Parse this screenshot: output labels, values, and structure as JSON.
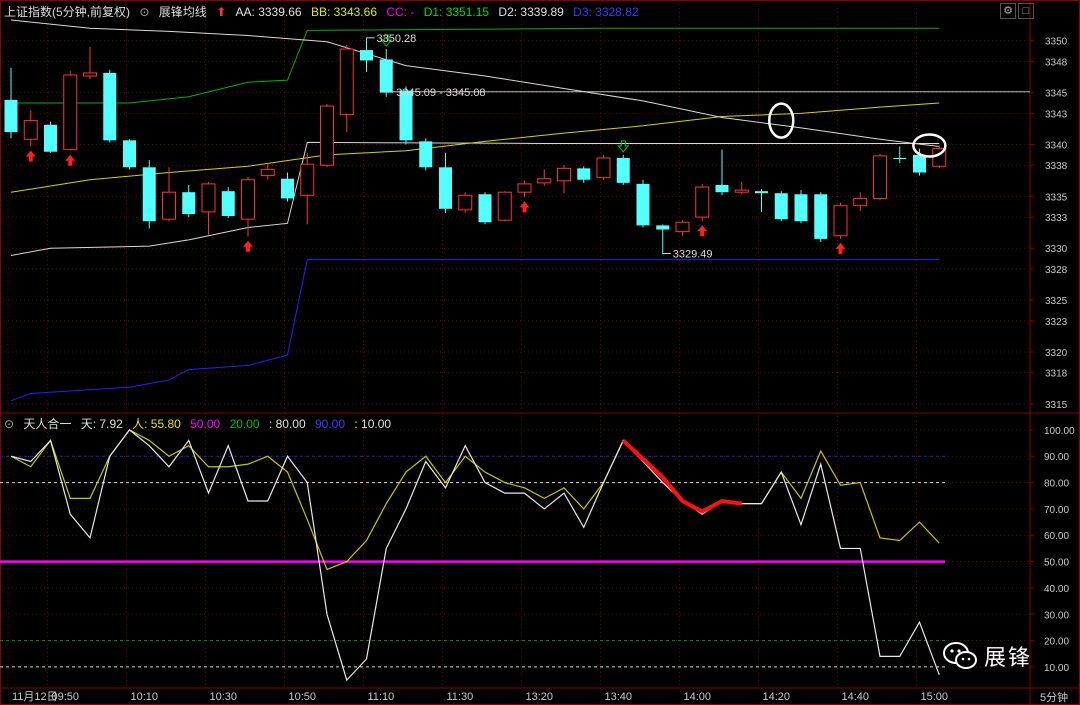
{
  "header": {
    "main_title": "上证指数(5分钟,前复权)",
    "indicator_name": "展锋均线",
    "aa": "AA: 3339.66",
    "bb": "BB: 3343.66",
    "cc": "CC: -",
    "d1": "D1: 3351.15",
    "d2": "D2: 3339.89",
    "d3": "D3: 3328.82"
  },
  "sub_header": {
    "name": "天人合一",
    "tian": "天: 7.92",
    "ren": "人: 55.80",
    "l50": "50.00",
    "l20": "20.00",
    "l80": ": 80.00",
    "l90": "90.00",
    "l10": ": 10.00"
  },
  "colors": {
    "up": "#ff3232",
    "down": "#54ffff",
    "aa": "#d8d8d8",
    "bb": "#d4d400",
    "d1": "#00b400",
    "d2": "#d8d8d8",
    "d3": "#2222ff",
    "magenta": "#ff00ff",
    "tian": "#e8e8e8",
    "ren": "#c8c800",
    "grid": "#8b0000"
  },
  "watermark": "展锋",
  "period_label": "5分钟",
  "chart_data": [
    {
      "type": "candlestick",
      "ylim": [
        3314.5,
        3352
      ],
      "yticks": [
        3315,
        3318,
        3320,
        3323,
        3325,
        3328,
        3330,
        3333,
        3335,
        3338,
        3340,
        3343,
        3345,
        3348,
        3350
      ],
      "candles": [
        {
          "o": 3344.3,
          "c": 3341.2,
          "h": 3347.4,
          "l": 3340.6
        },
        {
          "o": 3340.5,
          "c": 3342.3,
          "h": 3343.3,
          "l": 3339.8
        },
        {
          "o": 3341.9,
          "c": 3339.3,
          "h": 3342.2,
          "l": 3339.2
        },
        {
          "o": 3339.5,
          "c": 3346.7,
          "h": 3347.1,
          "l": 3339.4
        },
        {
          "o": 3346.6,
          "c": 3346.9,
          "h": 3349.4,
          "l": 3346.3
        },
        {
          "o": 3346.9,
          "c": 3340.4,
          "h": 3347.2,
          "l": 3340.2
        },
        {
          "o": 3340.4,
          "c": 3337.8,
          "h": 3340.5,
          "l": 3337.6
        },
        {
          "o": 3337.8,
          "c": 3332.6,
          "h": 3338.5,
          "l": 3331.9
        },
        {
          "o": 3332.8,
          "c": 3335.4,
          "h": 3337.8,
          "l": 3332.6
        },
        {
          "o": 3335.4,
          "c": 3333.3,
          "h": 3336.1,
          "l": 3333.0
        },
        {
          "o": 3333.5,
          "c": 3336.2,
          "h": 3336.4,
          "l": 3331.3
        },
        {
          "o": 3335.5,
          "c": 3333.1,
          "h": 3335.9,
          "l": 3332.9
        },
        {
          "o": 3332.8,
          "c": 3336.6,
          "h": 3336.9,
          "l": 3331.1
        },
        {
          "o": 3337.0,
          "c": 3337.6,
          "h": 3338.2,
          "l": 3336.6
        },
        {
          "o": 3336.7,
          "c": 3334.8,
          "h": 3337.3,
          "l": 3334.5
        },
        {
          "o": 3335.1,
          "c": 3338.1,
          "h": 3339.2,
          "l": 3332.3
        },
        {
          "o": 3338.0,
          "c": 3343.7,
          "h": 3343.9,
          "l": 3337.8
        },
        {
          "o": 3342.9,
          "c": 3349.2,
          "h": 3349.6,
          "l": 3341.2
        },
        {
          "o": 3349.1,
          "c": 3348.1,
          "h": 3350.3,
          "l": 3347.0
        },
        {
          "o": 3348.2,
          "c": 3345.0,
          "h": 3349.2,
          "l": 3344.6
        },
        {
          "o": 3345.2,
          "c": 3340.4,
          "h": 3345.6,
          "l": 3340.0
        },
        {
          "o": 3340.3,
          "c": 3337.8,
          "h": 3340.6,
          "l": 3337.5
        },
        {
          "o": 3337.8,
          "c": 3333.8,
          "h": 3339.2,
          "l": 3333.4
        },
        {
          "o": 3333.7,
          "c": 3335.1,
          "h": 3335.4,
          "l": 3333.4
        },
        {
          "o": 3335.2,
          "c": 3332.5,
          "h": 3335.4,
          "l": 3332.3
        },
        {
          "o": 3332.7,
          "c": 3335.4,
          "h": 3335.5,
          "l": 3332.6
        },
        {
          "o": 3335.4,
          "c": 3336.2,
          "h": 3336.5,
          "l": 3334.9
        },
        {
          "o": 3336.3,
          "c": 3336.7,
          "h": 3337.6,
          "l": 3336.0
        },
        {
          "o": 3336.5,
          "c": 3337.7,
          "h": 3338.0,
          "l": 3335.3
        },
        {
          "o": 3337.7,
          "c": 3336.6,
          "h": 3337.9,
          "l": 3336.3
        },
        {
          "o": 3336.8,
          "c": 3338.7,
          "h": 3339.0,
          "l": 3336.6
        },
        {
          "o": 3338.7,
          "c": 3336.3,
          "h": 3339.0,
          "l": 3336.1
        },
        {
          "o": 3336.2,
          "c": 3332.2,
          "h": 3336.6,
          "l": 3332.0
        },
        {
          "o": 3332.2,
          "c": 3331.8,
          "h": 3332.3,
          "l": 3329.4
        },
        {
          "o": 3331.6,
          "c": 3332.5,
          "h": 3332.7,
          "l": 3331.2
        },
        {
          "o": 3333.0,
          "c": 3335.9,
          "h": 3336.2,
          "l": 3332.6
        },
        {
          "o": 3336.1,
          "c": 3335.4,
          "h": 3339.5,
          "l": 3335.1
        },
        {
          "o": 3335.4,
          "c": 3335.6,
          "h": 3336.4,
          "l": 3335.2
        },
        {
          "o": 3335.5,
          "c": 3335.3,
          "h": 3335.7,
          "l": 3333.5
        },
        {
          "o": 3335.3,
          "c": 3332.8,
          "h": 3335.5,
          "l": 3332.6
        },
        {
          "o": 3335.2,
          "c": 3332.6,
          "h": 3335.6,
          "l": 3332.4
        },
        {
          "o": 3335.2,
          "c": 3330.9,
          "h": 3335.4,
          "l": 3330.6
        },
        {
          "o": 3331.2,
          "c": 3334.1,
          "h": 3334.4,
          "l": 3330.9
        },
        {
          "o": 3334.1,
          "c": 3334.8,
          "h": 3335.4,
          "l": 3333.6
        },
        {
          "o": 3334.8,
          "c": 3338.9,
          "h": 3339.1,
          "l": 3334.6
        },
        {
          "o": 3338.7,
          "c": 3338.6,
          "h": 3339.8,
          "l": 3338.2
        },
        {
          "o": 3339.0,
          "c": 3337.3,
          "h": 3339.6,
          "l": 3337.0
        },
        {
          "o": 3337.9,
          "c": 3339.6,
          "h": 3339.9,
          "l": 3337.7
        }
      ],
      "lines": {
        "aa": [
          [
            0,
            3352
          ],
          [
            4,
            3351.2
          ],
          [
            8,
            3350.9
          ],
          [
            12,
            3350.5
          ],
          [
            16,
            3349.9
          ],
          [
            20,
            3347.6
          ],
          [
            24,
            3346.6
          ],
          [
            28,
            3345.4
          ],
          [
            32,
            3344.2
          ],
          [
            36,
            3342.6
          ],
          [
            40,
            3341.6
          ],
          [
            44,
            3340.5
          ],
          [
            47,
            3339.8
          ]
        ],
        "bb": [
          [
            0,
            3335.4
          ],
          [
            4,
            3336.6
          ],
          [
            8,
            3337.3
          ],
          [
            12,
            3337.9
          ],
          [
            16,
            3339.0
          ],
          [
            20,
            3339.4
          ],
          [
            24,
            3340.3
          ],
          [
            28,
            3341.1
          ],
          [
            32,
            3341.8
          ],
          [
            36,
            3342.7
          ],
          [
            40,
            3343.0
          ],
          [
            44,
            3343.6
          ],
          [
            47,
            3344.0
          ]
        ],
        "d1": [
          [
            0,
            3344.0
          ],
          [
            6,
            3344.0
          ],
          [
            9,
            3344.6
          ],
          [
            12,
            3346.0
          ],
          [
            14,
            3346.2
          ],
          [
            15,
            3351.0
          ],
          [
            30,
            3351.2
          ],
          [
            47,
            3351.2
          ]
        ],
        "d2": [
          [
            0,
            3329.3
          ],
          [
            2,
            3330.0
          ],
          [
            7,
            3330.2
          ],
          [
            9,
            3330.8
          ],
          [
            12,
            3332.0
          ],
          [
            14,
            3332.4
          ],
          [
            15,
            3340.2
          ],
          [
            27,
            3340.1
          ],
          [
            47,
            3340.1
          ]
        ],
        "d3": [
          [
            0,
            3315.3
          ],
          [
            1,
            3316.0
          ],
          [
            6,
            3316.6
          ],
          [
            8,
            3317.3
          ],
          [
            9,
            3318.3
          ],
          [
            12,
            3318.7
          ],
          [
            14,
            3319.7
          ],
          [
            15,
            3328.9
          ],
          [
            27,
            3328.9
          ],
          [
            47,
            3328.9
          ]
        ]
      },
      "hline": 3345.08,
      "annotations": [
        {
          "text": "3350.28",
          "i": 18,
          "price": 3350.28
        },
        {
          "text": "3345.09 - 3345.08",
          "i": 19,
          "price": 3345.08
        },
        {
          "text": "3329.49",
          "i": 33,
          "price": 3329.49
        }
      ],
      "up_arrows": [
        1,
        3,
        12,
        26,
        35,
        42
      ],
      "down_arrows": [
        19,
        31
      ],
      "circles": [
        {
          "i": 39,
          "price": 3342.3
        },
        {
          "i": 46.5,
          "price": 3339.9
        }
      ]
    },
    {
      "type": "line",
      "ylim": [
        2,
        103
      ],
      "yticks": [
        10,
        20,
        30,
        40,
        50,
        60,
        70,
        80,
        90,
        100
      ],
      "hlines": [
        {
          "y": 90,
          "color": "#2222cc",
          "dash": true
        },
        {
          "y": 80,
          "color": "#d8d8d8",
          "dash": true
        },
        {
          "y": 50,
          "color": "#ff00ff",
          "dash": false
        },
        {
          "y": 20,
          "color": "#00a000",
          "dash": true
        },
        {
          "y": 10,
          "color": "#d8d8d8",
          "dash": true
        }
      ],
      "series": [
        {
          "key": "ren",
          "values": [
            90,
            86,
            96,
            74,
            74,
            90,
            100,
            96,
            90,
            94,
            86,
            86,
            87,
            90,
            84,
            66,
            47,
            50,
            58,
            72,
            84,
            90,
            80,
            90,
            84,
            80,
            78,
            74,
            78,
            70,
            80,
            96,
            89,
            82,
            73,
            69,
            73,
            72,
            72,
            84,
            74,
            92,
            79,
            80,
            59,
            58,
            65,
            57
          ]
        },
        {
          "key": "tian",
          "values": [
            90,
            88,
            96,
            68,
            59,
            90,
            100,
            94,
            86,
            96,
            76,
            94,
            73,
            73,
            90,
            80,
            30,
            5,
            13,
            55,
            70,
            88,
            78,
            94,
            80,
            76,
            76,
            70,
            76,
            63,
            80,
            96,
            88,
            80,
            73,
            68,
            73,
            72,
            72,
            84,
            64,
            87,
            55,
            55,
            14,
            14,
            27,
            7
          ]
        }
      ],
      "highlight": {
        "from": 31,
        "to": 37
      }
    }
  ],
  "time_axis": {
    "labels": [
      {
        "i": 0,
        "text": "11月12日"
      },
      {
        "i": 2,
        "text": "09:50"
      },
      {
        "i": 6,
        "text": "10:10"
      },
      {
        "i": 10,
        "text": "10:30"
      },
      {
        "i": 14,
        "text": "10:50"
      },
      {
        "i": 18,
        "text": "11:10"
      },
      {
        "i": 22,
        "text": "11:30"
      },
      {
        "i": 26,
        "text": "13:20"
      },
      {
        "i": 30,
        "text": "13:40"
      },
      {
        "i": 34,
        "text": "14:00"
      },
      {
        "i": 38,
        "text": "14:20"
      },
      {
        "i": 42,
        "text": "14:40"
      },
      {
        "i": 46,
        "text": "15:00"
      }
    ]
  }
}
